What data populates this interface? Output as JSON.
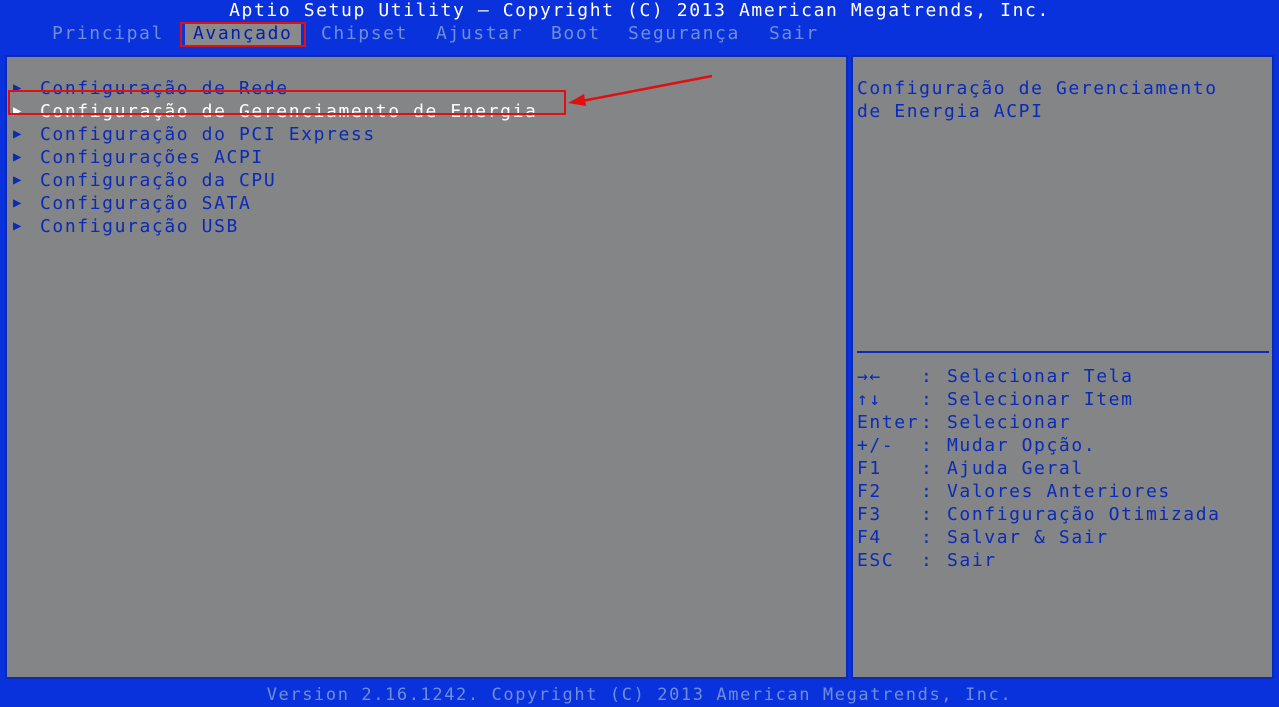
{
  "header": {
    "title": "Aptio Setup Utility – Copyright (C) 2013 American Megatrends, Inc.",
    "tabs": [
      {
        "label": "Principal"
      },
      {
        "label": "Avançado"
      },
      {
        "label": "Chipset"
      },
      {
        "label": "Ajustar"
      },
      {
        "label": "Boot"
      },
      {
        "label": "Segurança"
      },
      {
        "label": "Sair"
      }
    ],
    "active_tab": "Avançado"
  },
  "main": {
    "items": [
      {
        "label": "Configuração de Rede"
      },
      {
        "label": "Configuração de Gerenciamento de Energia"
      },
      {
        "label": "Configuração do PCI Express"
      },
      {
        "label": "Configurações ACPI"
      },
      {
        "label": "Configuração da CPU"
      },
      {
        "label": "Configuração SATA"
      },
      {
        "label": "Configuração USB"
      }
    ],
    "selected_item": "Configuração de Gerenciamento de Energia",
    "item_marker": "▶"
  },
  "help": {
    "description": "Configuração de Gerenciamento\nde Energia ACPI",
    "keys": [
      {
        "key": "→←",
        "action": "Selecionar Tela"
      },
      {
        "key": "↑↓",
        "action": "Selecionar Item"
      },
      {
        "key": "Enter",
        "action": "Selecionar"
      },
      {
        "key": "+/-",
        "action": "Mudar Opção."
      },
      {
        "key": "F1",
        "action": "Ajuda Geral"
      },
      {
        "key": "F2",
        "action": "Valores Anteriores"
      },
      {
        "key": "F3",
        "action": "Configuração Otimizada"
      },
      {
        "key": "F4",
        "action": "Salvar & Sair"
      },
      {
        "key": "ESC",
        "action": "Sair"
      }
    ]
  },
  "footer": {
    "text": "Version 2.16.1242. Copyright (C) 2013 American Megatrends, Inc."
  },
  "colors": {
    "background_blue": "#0a32dc",
    "panel_gray": "#838587",
    "text_blue": "#0a2ab8",
    "inactive_tab": "#6f8ed8",
    "annotation_red": "#e01010"
  }
}
